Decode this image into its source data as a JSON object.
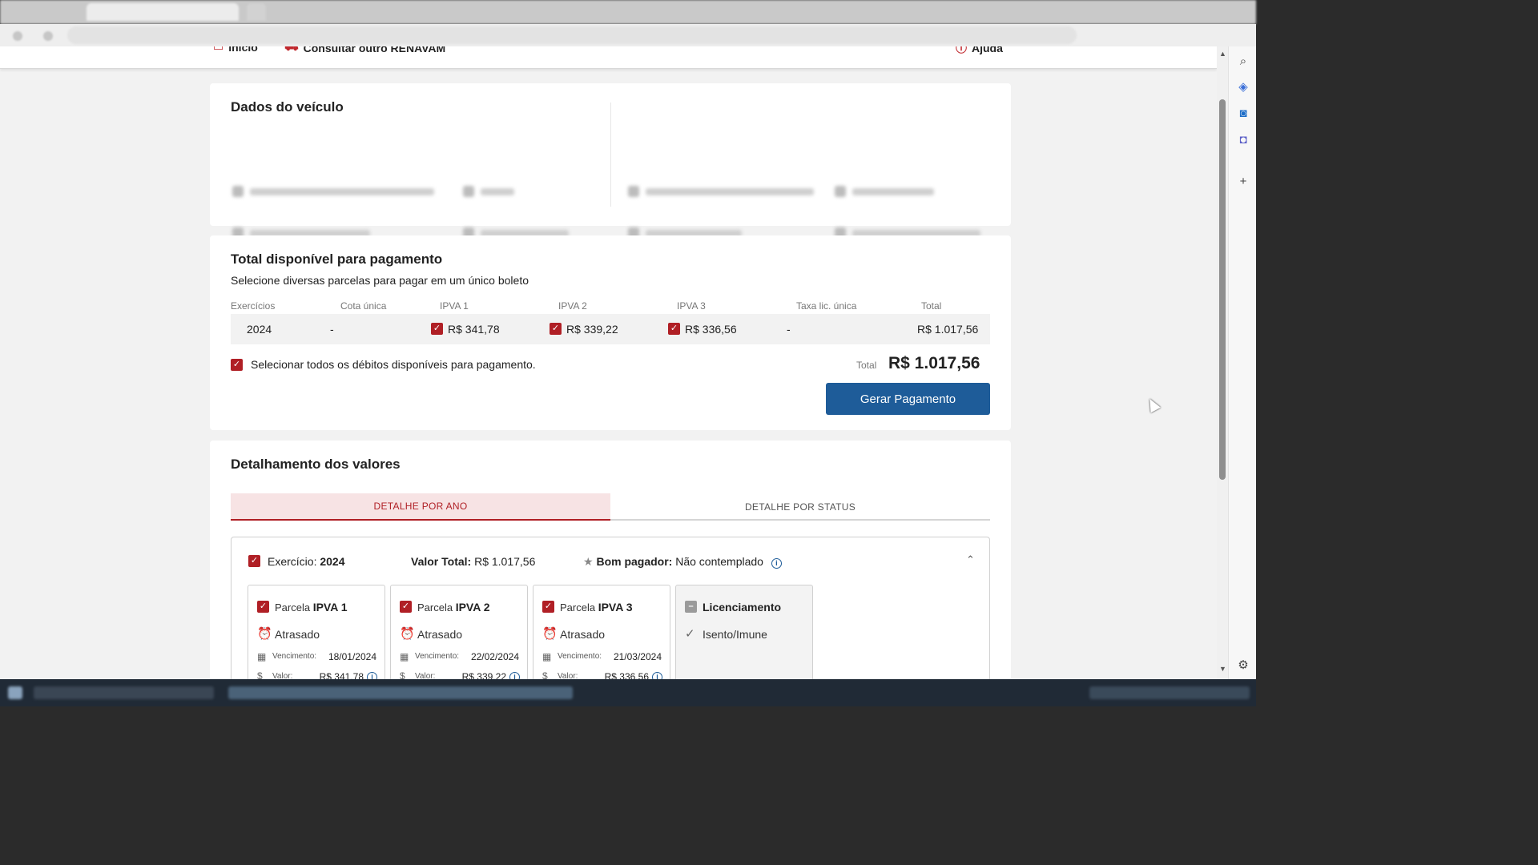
{
  "header": {
    "inicio": "Início",
    "consultar": "Consultar outro RENAVAM",
    "ajuda": "Ajuda"
  },
  "vehicle": {
    "title": "Dados do veículo"
  },
  "payment": {
    "title": "Total disponível para pagamento",
    "subtitle": "Selecione diversas parcelas para pagar em um único boleto",
    "columns": [
      "Exercícios",
      "Cota única",
      "IPVA 1",
      "IPVA 2",
      "IPVA 3",
      "Taxa lic. única",
      "Total"
    ],
    "row": {
      "year": "2024",
      "cota_unica": "-",
      "ipva1": "R$ 341,78",
      "ipva2": "R$ 339,22",
      "ipva3": "R$ 336,56",
      "taxa": "-",
      "total": "R$ 1.017,56"
    },
    "select_all_label": "Selecionar todos os débitos disponíveis para pagamento.",
    "total_caption": "Total",
    "total_value": "R$ 1.017,56",
    "generate_button": "Gerar Pagamento"
  },
  "details": {
    "title": "Detalhamento dos valores",
    "tabs": [
      "DETALHE POR ANO",
      "DETALHE POR STATUS"
    ],
    "active_tab": "DETALHE POR ANO",
    "year_box": {
      "exercicio_label": "Exercício:",
      "exercicio_value": "2024",
      "valor_total_label": "Valor Total:",
      "valor_total_value": "R$ 1.017,56",
      "bom_pagador_label": "Bom pagador:",
      "bom_pagador_value": "Não contemplado"
    },
    "parcels": [
      {
        "prefix": "Parcela",
        "name": "IPVA 1",
        "status": "Atrasado",
        "venc_label": "Vencimento:",
        "venc_date": "18/01/2024",
        "valor_label": "Valor:",
        "valor": "R$ 341,78"
      },
      {
        "prefix": "Parcela",
        "name": "IPVA 2",
        "status": "Atrasado",
        "venc_label": "Vencimento:",
        "venc_date": "22/02/2024",
        "valor_label": "Valor:",
        "valor": "R$ 339,22"
      },
      {
        "prefix": "Parcela",
        "name": "IPVA 3",
        "status": "Atrasado",
        "venc_label": "Vencimento:",
        "venc_date": "21/03/2024",
        "valor_label": "Valor:",
        "valor": "R$ 336,56"
      }
    ],
    "licenciamento": {
      "name": "Licenciamento",
      "status": "Isento/Imune"
    }
  },
  "colors": {
    "accent_red": "#b01f25",
    "primary_blue": "#1e5c99",
    "status_orange": "#e08a1e"
  }
}
